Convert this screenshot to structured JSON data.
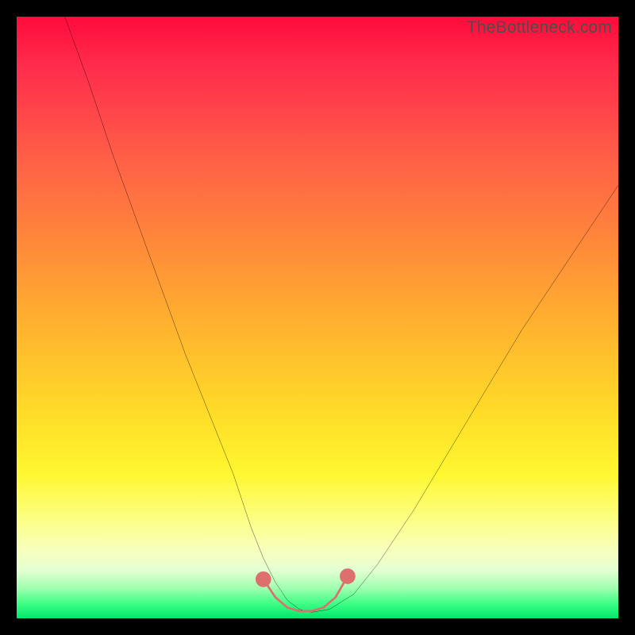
{
  "watermark": {
    "text": "TheBottleneck.com"
  },
  "colors": {
    "curve_stroke": "#000000",
    "accent_stroke": "#dd6f6f",
    "frame": "#000000"
  },
  "chart_data": {
    "type": "line",
    "title": "",
    "xlabel": "",
    "ylabel": "",
    "xlim": [
      0,
      100
    ],
    "ylim": [
      0,
      100
    ],
    "grid": false,
    "legend": false,
    "series": [
      {
        "name": "bottleneck-curve",
        "x": [
          8,
          12,
          16,
          20,
          24,
          28,
          32,
          36,
          39,
          41,
          43,
          45,
          47,
          49,
          52,
          56,
          60,
          66,
          72,
          78,
          84,
          90,
          96,
          100
        ],
        "values": [
          100,
          89,
          77,
          66,
          55,
          44,
          34,
          24,
          15,
          10,
          6,
          3,
          1.5,
          1,
          1.5,
          4,
          9,
          18,
          28,
          38,
          48,
          57,
          66,
          72
        ]
      },
      {
        "name": "sweet-spot-marker",
        "x": [
          41,
          43,
          45,
          47,
          49,
          51,
          53,
          55
        ],
        "values": [
          6.5,
          3.5,
          1.8,
          1.2,
          1.2,
          1.8,
          3.5,
          7
        ]
      }
    ],
    "annotations": [
      {
        "text": "TheBottleneck.com",
        "position": "top-right"
      }
    ]
  }
}
